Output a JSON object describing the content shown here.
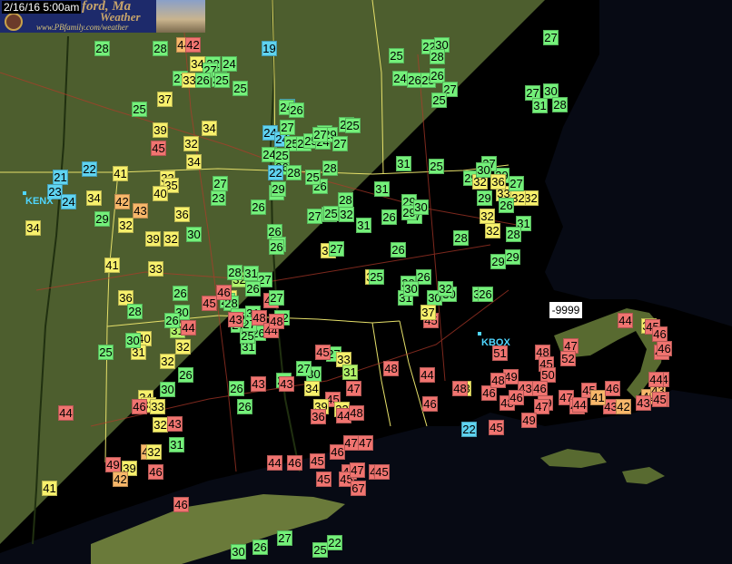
{
  "header": {
    "timestamp": "2/16/16 5:00am",
    "brand_title": "Bedford, Ma",
    "brand_title_visible": "ford, Ma",
    "brand_subtitle": "Weather",
    "brand_url": "www.PBfamily.com/weather"
  },
  "sites": [
    {
      "id": "kenx",
      "label": "KENX"
    },
    {
      "id": "kbox",
      "label": "KBOX"
    }
  ],
  "missing_flag": "-9999",
  "colors": {
    "c-blue": "#5fd3f0",
    "c-green": "#74f07a",
    "c-lgreen": "#b2f36a",
    "c-yellow": "#f7f06c",
    "c-orange": "#f7b76a",
    "c-red": "#f07470"
  },
  "stations": [
    {
      "v": "28",
      "c": "c-green"
    },
    {
      "v": "28",
      "c": "c-green"
    },
    {
      "v": "44",
      "c": "c-orange"
    },
    {
      "v": "42",
      "c": "c-red"
    },
    {
      "v": "19",
      "c": "c-blue"
    },
    {
      "v": "27",
      "c": "c-green"
    },
    {
      "v": "22",
      "c": "c-green"
    },
    {
      "v": "30",
      "c": "c-green"
    },
    {
      "v": "28",
      "c": "c-green"
    },
    {
      "v": "25",
      "c": "c-green"
    },
    {
      "v": "34",
      "c": "c-yellow"
    },
    {
      "v": "22",
      "c": "c-green"
    },
    {
      "v": "24",
      "c": "c-green"
    },
    {
      "v": "27",
      "c": "c-green"
    },
    {
      "v": "26",
      "c": "c-green"
    },
    {
      "v": "27",
      "c": "c-green"
    },
    {
      "v": "33",
      "c": "c-yellow"
    },
    {
      "v": "26",
      "c": "c-green"
    },
    {
      "v": "25",
      "c": "c-green"
    },
    {
      "v": "25",
      "c": "c-green"
    },
    {
      "v": "24",
      "c": "c-green"
    },
    {
      "v": "26",
      "c": "c-green"
    },
    {
      "v": "25",
      "c": "c-green"
    },
    {
      "v": "26",
      "c": "c-green"
    },
    {
      "v": "27",
      "c": "c-green"
    },
    {
      "v": "37",
      "c": "c-yellow"
    },
    {
      "v": "25",
      "c": "c-green"
    },
    {
      "v": "25",
      "c": "c-green"
    },
    {
      "v": "22",
      "c": "c-blue"
    },
    {
      "v": "27",
      "c": "c-green"
    },
    {
      "v": "30",
      "c": "c-green"
    },
    {
      "v": "28",
      "c": "c-green"
    },
    {
      "v": "31",
      "c": "c-green"
    },
    {
      "v": "34",
      "c": "c-yellow"
    },
    {
      "v": "39",
      "c": "c-yellow"
    },
    {
      "v": "24",
      "c": "c-blue"
    },
    {
      "v": "24",
      "c": "c-blue"
    },
    {
      "v": "25",
      "c": "c-green"
    },
    {
      "v": "26",
      "c": "c-green"
    },
    {
      "v": "45",
      "c": "c-red"
    },
    {
      "v": "32",
      "c": "c-yellow"
    },
    {
      "v": "25",
      "c": "c-green"
    },
    {
      "v": "25",
      "c": "c-green"
    },
    {
      "v": "24",
      "c": "c-green"
    },
    {
      "v": "29",
      "c": "c-green"
    },
    {
      "v": "25",
      "c": "c-green"
    },
    {
      "v": "27",
      "c": "c-green"
    },
    {
      "v": "34",
      "c": "c-yellow"
    },
    {
      "v": "24",
      "c": "c-green"
    },
    {
      "v": "26",
      "c": "c-green"
    },
    {
      "v": "22",
      "c": "c-blue"
    },
    {
      "v": "28",
      "c": "c-green"
    },
    {
      "v": "28",
      "c": "c-green"
    },
    {
      "v": "21",
      "c": "c-blue"
    },
    {
      "v": "22",
      "c": "c-blue"
    },
    {
      "v": "41",
      "c": "c-yellow"
    },
    {
      "v": "33",
      "c": "c-yellow"
    },
    {
      "v": "25",
      "c": "c-green"
    },
    {
      "v": "29",
      "c": "c-green"
    },
    {
      "v": "29",
      "c": "c-green"
    },
    {
      "v": "27",
      "c": "c-green"
    },
    {
      "v": "35",
      "c": "c-yellow"
    },
    {
      "v": "23",
      "c": "c-blue"
    },
    {
      "v": "24",
      "c": "c-blue"
    },
    {
      "v": "34",
      "c": "c-yellow"
    },
    {
      "v": "40",
      "c": "c-yellow"
    },
    {
      "v": "26",
      "c": "c-green"
    },
    {
      "v": "23",
      "c": "c-green"
    },
    {
      "v": "24",
      "c": "c-green"
    },
    {
      "v": "27",
      "c": "c-green"
    },
    {
      "v": "31",
      "c": "c-green"
    },
    {
      "v": "32",
      "c": "c-yellow"
    },
    {
      "v": "29",
      "c": "c-green"
    },
    {
      "v": "30",
      "c": "c-green"
    },
    {
      "v": "32",
      "c": "c-yellow"
    },
    {
      "v": "42",
      "c": "c-orange"
    },
    {
      "v": "43",
      "c": "c-orange"
    },
    {
      "v": "36",
      "c": "c-yellow"
    },
    {
      "v": "26",
      "c": "c-green"
    },
    {
      "v": "27",
      "c": "c-green"
    },
    {
      "v": "28",
      "c": "c-green"
    },
    {
      "v": "32",
      "c": "c-green"
    },
    {
      "v": "31",
      "c": "c-green"
    },
    {
      "v": "26",
      "c": "c-green"
    },
    {
      "v": "27",
      "c": "c-green"
    },
    {
      "v": "32",
      "c": "c-yellow"
    },
    {
      "v": "29",
      "c": "c-green"
    },
    {
      "v": "39",
      "c": "c-yellow"
    },
    {
      "v": "32",
      "c": "c-yellow"
    },
    {
      "v": "30",
      "c": "c-green"
    },
    {
      "v": "26",
      "c": "c-green"
    },
    {
      "v": "28",
      "c": "c-green"
    },
    {
      "v": "26",
      "c": "c-green"
    },
    {
      "v": "32",
      "c": "c-yellow"
    },
    {
      "v": "28",
      "c": "c-green"
    },
    {
      "v": "34",
      "c": "c-yellow"
    },
    {
      "v": "41",
      "c": "c-yellow"
    },
    {
      "v": "33",
      "c": "c-yellow"
    },
    {
      "v": "37",
      "c": "c-yellow"
    },
    {
      "v": "26",
      "c": "c-green"
    },
    {
      "v": "30",
      "c": "c-green"
    },
    {
      "v": "36",
      "c": "c-yellow"
    },
    {
      "v": "45",
      "c": "c-red"
    },
    {
      "v": "32",
      "c": "c-lgreen"
    },
    {
      "v": "39",
      "c": "c-yellow"
    },
    {
      "v": "46",
      "c": "c-red"
    },
    {
      "v": "30",
      "c": "c-green"
    },
    {
      "v": "28",
      "c": "c-green"
    },
    {
      "v": "25",
      "c": "c-green"
    },
    {
      "v": "26",
      "c": "c-green"
    },
    {
      "v": "30",
      "c": "c-green"
    },
    {
      "v": "31",
      "c": "c-lgreen"
    },
    {
      "v": "40",
      "c": "c-yellow"
    },
    {
      "v": "31",
      "c": "c-green"
    },
    {
      "v": "26",
      "c": "c-green"
    },
    {
      "v": "44",
      "c": "c-red"
    },
    {
      "v": "31",
      "c": "c-yellow"
    },
    {
      "v": "32",
      "c": "c-yellow"
    },
    {
      "v": "26",
      "c": "c-green"
    },
    {
      "v": "31",
      "c": "c-green"
    },
    {
      "v": "30",
      "c": "c-green"
    },
    {
      "v": "32",
      "c": "c-yellow"
    },
    {
      "v": "34",
      "c": "c-yellow"
    },
    {
      "v": "30",
      "c": "c-green"
    },
    {
      "v": "26",
      "c": "c-green"
    },
    {
      "v": "43",
      "c": "c-red"
    },
    {
      "v": "33",
      "c": "c-yellow"
    },
    {
      "v": "33",
      "c": "c-yellow"
    },
    {
      "v": "26",
      "c": "c-green"
    },
    {
      "v": "28",
      "c": "c-green"
    },
    {
      "v": "27",
      "c": "c-green"
    },
    {
      "v": "33",
      "c": "c-yellow"
    },
    {
      "v": "31",
      "c": "c-lgreen"
    },
    {
      "v": "43",
      "c": "c-red"
    },
    {
      "v": "45",
      "c": "c-red"
    },
    {
      "v": "30",
      "c": "c-green"
    },
    {
      "v": "34",
      "c": "c-yellow"
    },
    {
      "v": "39",
      "c": "c-yellow"
    },
    {
      "v": "33",
      "c": "c-yellow"
    },
    {
      "v": "36",
      "c": "c-red"
    },
    {
      "v": "47",
      "c": "c-red"
    },
    {
      "v": "46",
      "c": "c-red"
    },
    {
      "v": "44",
      "c": "c-red"
    },
    {
      "v": "48",
      "c": "c-red"
    },
    {
      "v": "32",
      "c": "c-yellow"
    },
    {
      "v": "43",
      "c": "c-red"
    },
    {
      "v": "27",
      "c": "c-green"
    },
    {
      "v": "44",
      "c": "c-red"
    },
    {
      "v": "31",
      "c": "c-green"
    },
    {
      "v": "45",
      "c": "c-red"
    },
    {
      "v": "43",
      "c": "c-orange"
    },
    {
      "v": "49",
      "c": "c-red"
    },
    {
      "v": "39",
      "c": "c-yellow"
    },
    {
      "v": "32",
      "c": "c-yellow"
    },
    {
      "v": "41",
      "c": "c-yellow"
    },
    {
      "v": "42",
      "c": "c-orange"
    },
    {
      "v": "46",
      "c": "c-red"
    },
    {
      "v": "44",
      "c": "c-red"
    },
    {
      "v": "46",
      "c": "c-red"
    },
    {
      "v": "45",
      "c": "c-red"
    },
    {
      "v": "45",
      "c": "c-red"
    },
    {
      "v": "47",
      "c": "c-red"
    },
    {
      "v": "47",
      "c": "c-red"
    },
    {
      "v": "44",
      "c": "c-red"
    },
    {
      "v": "45",
      "c": "c-red"
    },
    {
      "v": "67",
      "c": "c-red"
    },
    {
      "v": "47",
      "c": "c-red"
    },
    {
      "v": "45",
      "c": "c-red"
    },
    {
      "v": "46",
      "c": "c-red"
    },
    {
      "v": "46",
      "c": "c-red"
    },
    {
      "v": "47",
      "c": "c-red"
    },
    {
      "v": "45",
      "c": "c-red"
    },
    {
      "v": "48",
      "c": "c-red"
    },
    {
      "v": "33",
      "c": "c-yellow"
    },
    {
      "v": "44",
      "c": "c-red"
    },
    {
      "v": "48",
      "c": "c-red"
    },
    {
      "v": "46",
      "c": "c-red"
    },
    {
      "v": "46",
      "c": "c-red"
    },
    {
      "v": "22",
      "c": "c-blue"
    },
    {
      "v": "51",
      "c": "c-red"
    },
    {
      "v": "48",
      "c": "c-red"
    },
    {
      "v": "45",
      "c": "c-red"
    },
    {
      "v": "47",
      "c": "c-red"
    },
    {
      "v": "52",
      "c": "c-red"
    },
    {
      "v": "50",
      "c": "c-red"
    },
    {
      "v": "49",
      "c": "c-red"
    },
    {
      "v": "48",
      "c": "c-red"
    },
    {
      "v": "43",
      "c": "c-red"
    },
    {
      "v": "46",
      "c": "c-red"
    },
    {
      "v": "49",
      "c": "c-red"
    },
    {
      "v": "47",
      "c": "c-red"
    },
    {
      "v": "45",
      "c": "c-red"
    },
    {
      "v": "43",
      "c": "c-red"
    },
    {
      "v": "48",
      "c": "c-red"
    },
    {
      "v": "46",
      "c": "c-red"
    },
    {
      "v": "47",
      "c": "c-red"
    },
    {
      "v": "49",
      "c": "c-red"
    },
    {
      "v": "45",
      "c": "c-red"
    },
    {
      "v": "41",
      "c": "c-orange"
    },
    {
      "v": "46",
      "c": "c-red"
    },
    {
      "v": "44",
      "c": "c-red"
    },
    {
      "v": "42",
      "c": "c-orange"
    },
    {
      "v": "43",
      "c": "c-orange"
    },
    {
      "v": "42",
      "c": "c-orange"
    },
    {
      "v": "43",
      "c": "c-red"
    },
    {
      "v": "47",
      "c": "c-red"
    },
    {
      "v": "44",
      "c": "c-red"
    },
    {
      "v": "48",
      "c": "c-red"
    },
    {
      "v": "44",
      "c": "c-red"
    },
    {
      "v": "30",
      "c": "c-yellow"
    },
    {
      "v": "45",
      "c": "c-red"
    },
    {
      "v": "46",
      "c": "c-red"
    },
    {
      "v": "46",
      "c": "c-red"
    },
    {
      "v": "44",
      "c": "c-red"
    },
    {
      "v": "45",
      "c": "c-red"
    },
    {
      "v": "25",
      "c": "c-green"
    },
    {
      "v": "22",
      "c": "c-green"
    },
    {
      "v": "30",
      "c": "c-green"
    },
    {
      "v": "26",
      "c": "c-green"
    },
    {
      "v": "27",
      "c": "c-green"
    },
    {
      "v": "24",
      "c": "c-green"
    },
    {
      "v": "26",
      "c": "c-green"
    },
    {
      "v": "25",
      "c": "c-green"
    },
    {
      "v": "27",
      "c": "c-green"
    },
    {
      "v": "25",
      "c": "c-green"
    },
    {
      "v": "27",
      "c": "c-green"
    },
    {
      "v": "29",
      "c": "c-green"
    },
    {
      "v": "25",
      "c": "c-green"
    },
    {
      "v": "25",
      "c": "c-green"
    },
    {
      "v": "28",
      "c": "c-green"
    },
    {
      "v": "29",
      "c": "c-green"
    },
    {
      "v": "29",
      "c": "c-green"
    },
    {
      "v": "30",
      "c": "c-green"
    },
    {
      "v": "32",
      "c": "c-yellow"
    },
    {
      "v": "32",
      "c": "c-yellow"
    },
    {
      "v": "32",
      "c": "c-yellow"
    },
    {
      "v": "33",
      "c": "c-yellow"
    },
    {
      "v": "30",
      "c": "c-green"
    },
    {
      "v": "36",
      "c": "c-yellow"
    },
    {
      "v": "27",
      "c": "c-green"
    },
    {
      "v": "26",
      "c": "c-green"
    },
    {
      "v": "31",
      "c": "c-green"
    },
    {
      "v": "28",
      "c": "c-green"
    },
    {
      "v": "29",
      "c": "c-green"
    },
    {
      "v": "29",
      "c": "c-green"
    },
    {
      "v": "31",
      "c": "c-green"
    },
    {
      "v": "26",
      "c": "c-green"
    },
    {
      "v": "30",
      "c": "c-green"
    },
    {
      "v": "30",
      "c": "c-green"
    },
    {
      "v": "31",
      "c": "c-green"
    },
    {
      "v": "30",
      "c": "c-green"
    },
    {
      "v": "45",
      "c": "c-red"
    },
    {
      "v": "37",
      "c": "c-yellow"
    },
    {
      "v": "32",
      "c": "c-green"
    },
    {
      "v": "26",
      "c": "c-green"
    },
    {
      "v": "25",
      "c": "c-green"
    },
    {
      "v": "27",
      "c": "c-green"
    },
    {
      "v": "28",
      "c": "c-green"
    },
    {
      "v": "31",
      "c": "c-green"
    },
    {
      "v": "27",
      "c": "c-green"
    },
    {
      "v": "26",
      "c": "c-green"
    },
    {
      "v": "25",
      "c": "c-green"
    },
    {
      "v": "27",
      "c": "c-green"
    },
    {
      "v": "27",
      "c": "c-green"
    },
    {
      "v": "32",
      "c": "c-green"
    },
    {
      "v": "28",
      "c": "c-green"
    },
    {
      "v": "26",
      "c": "c-green"
    },
    {
      "v": "25",
      "c": "c-green"
    },
    {
      "v": "27",
      "c": "c-green"
    },
    {
      "v": "26",
      "c": "c-green"
    },
    {
      "v": "48",
      "c": "c-red"
    },
    {
      "v": "43",
      "c": "c-red"
    },
    {
      "v": "44",
      "c": "c-red"
    },
    {
      "v": "48",
      "c": "c-red"
    },
    {
      "v": "46",
      "c": "c-red"
    }
  ]
}
